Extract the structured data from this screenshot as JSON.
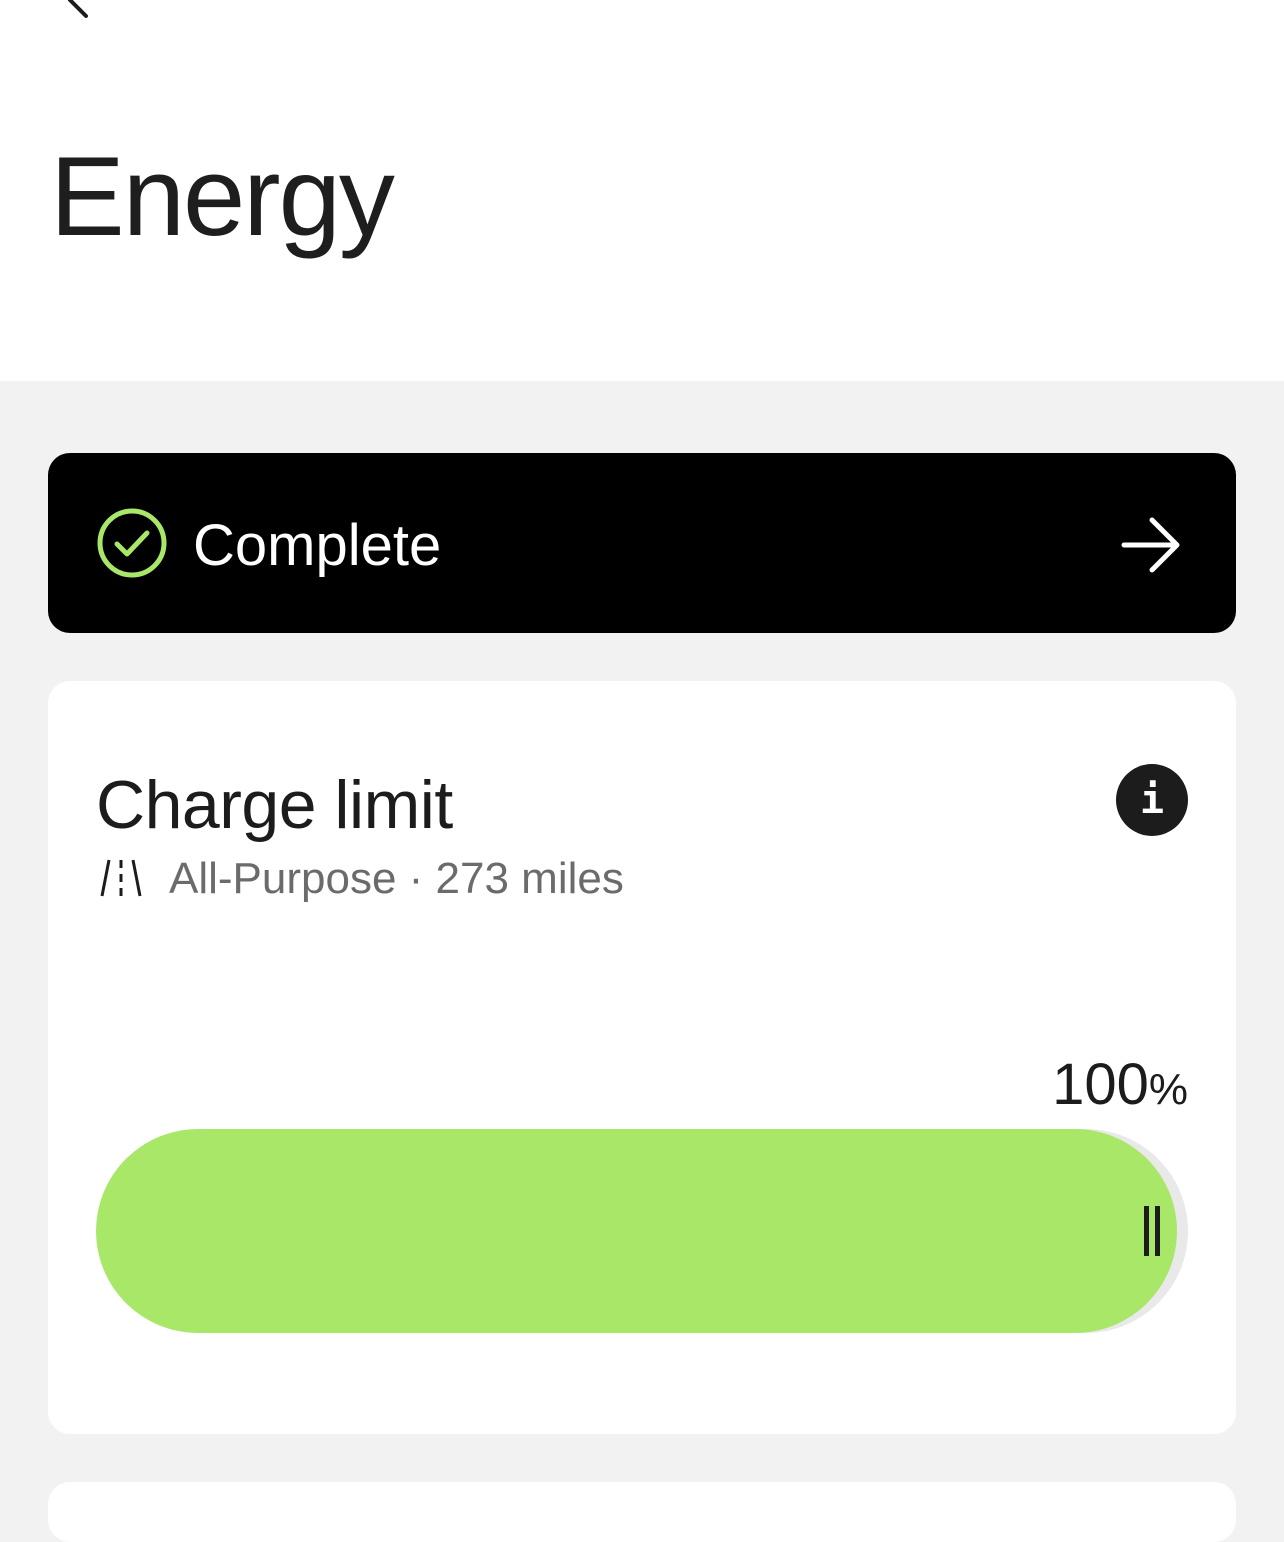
{
  "header": {
    "title": "Energy",
    "back_icon": "chevron-left-icon"
  },
  "status": {
    "label": "Complete",
    "icon": "check-circle-icon",
    "arrow_icon": "arrow-right-icon",
    "check_color": "#a9e769"
  },
  "charge_limit": {
    "title": "Charge limit",
    "info_icon": "info-icon",
    "info_glyph": "i",
    "mode_icon": "road-icon",
    "mode_text": "All-Purpose · 273 miles",
    "percent_value": "100",
    "percent_unit": "%",
    "level_fraction": 0.99,
    "fill_color": "#a9e769",
    "handle_icon": "drag-handle-icon"
  }
}
